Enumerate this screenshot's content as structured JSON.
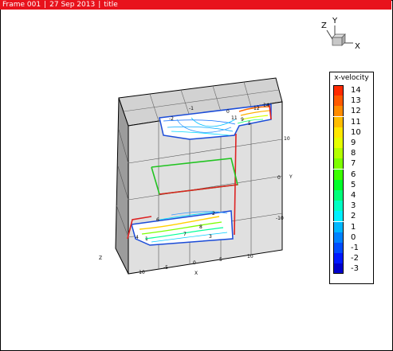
{
  "header": {
    "frame_label": "Frame 001",
    "date": "27 Sep 2013",
    "title": "title"
  },
  "axis_triad": {
    "x": "X",
    "y": "Y",
    "z": "Z"
  },
  "plot_axes": {
    "x_label": "X",
    "y_label": "Y",
    "z_label": "Z",
    "x_ticks": [
      "-10",
      "-5",
      "0",
      "5",
      "10"
    ],
    "y_ticks": [
      "10",
      "0",
      "-10"
    ],
    "y_tick_side": [
      "10",
      "0",
      "-10"
    ]
  },
  "legend": {
    "title": "x-velocity",
    "levels": [
      "14",
      "13",
      "12",
      "11",
      "10",
      "9",
      "8",
      "7",
      "6",
      "5",
      "4",
      "3",
      "2",
      "1",
      "0",
      "-1",
      "-2",
      "-3"
    ],
    "colors": [
      "#ff2b00",
      "#ff5a00",
      "#ff8c00",
      "#ffbd00",
      "#ffe800",
      "#e6ff00",
      "#b4ff00",
      "#7dff00",
      "#3cff00",
      "#00ff2b",
      "#00ff7a",
      "#00ffc4",
      "#00f0ff",
      "#00b8ff",
      "#0082ff",
      "#004dff",
      "#0019ff",
      "#0000cc"
    ]
  },
  "contour_labels": [
    "12",
    "14",
    "11",
    "9",
    "-2",
    "5",
    "8",
    "4",
    "6",
    "2",
    "3",
    "7",
    "1",
    "-1",
    "0"
  ]
}
